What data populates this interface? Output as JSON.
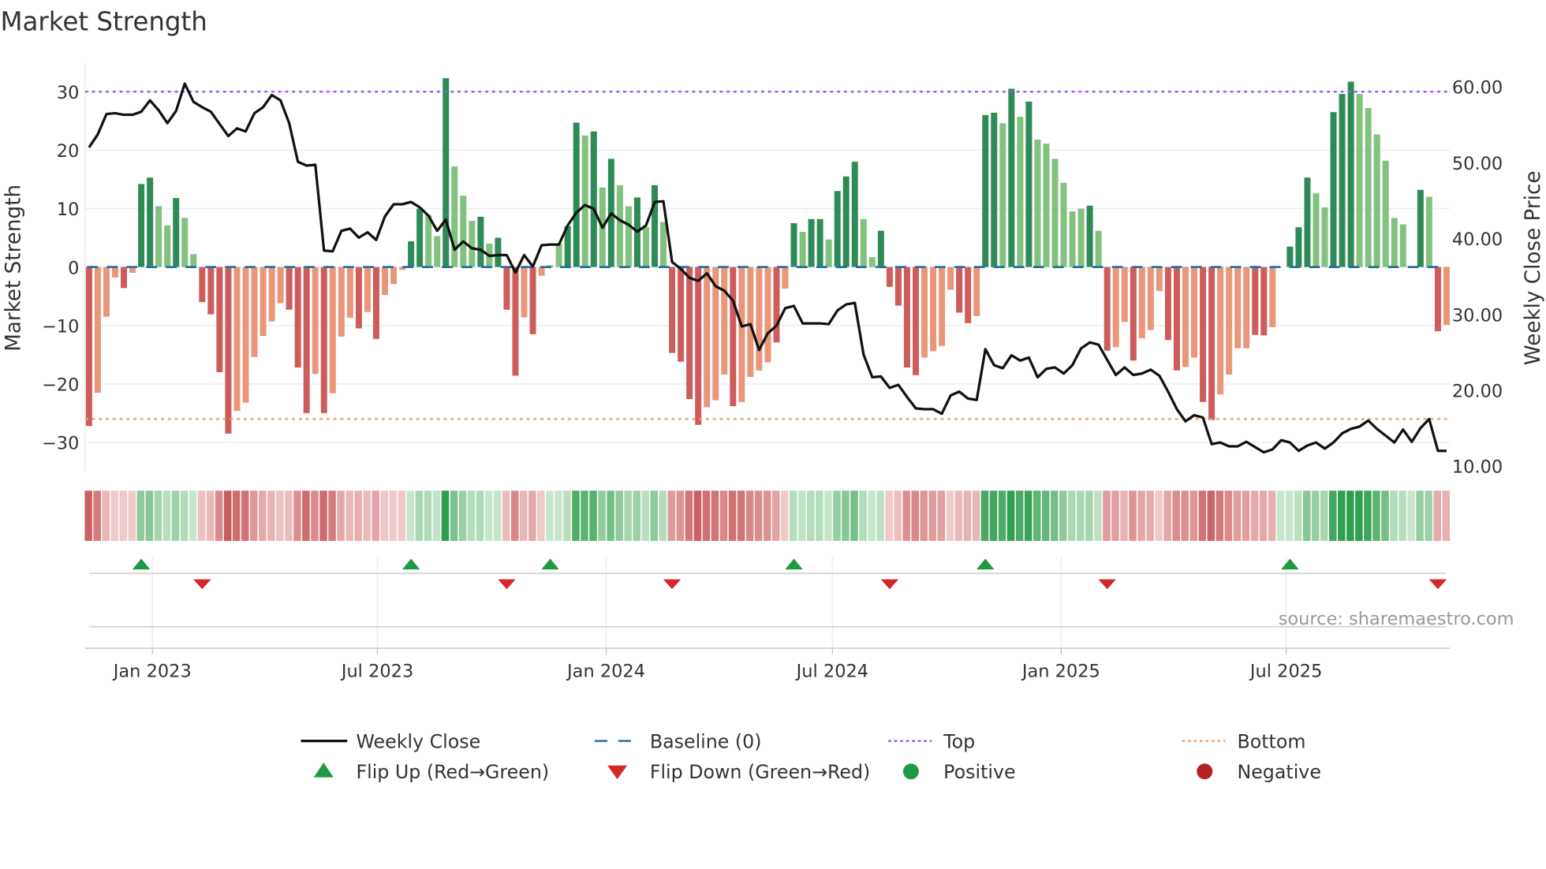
{
  "title": "Market Strength",
  "source": "source: sharemaestro.com",
  "colors": {
    "strong_pos": "#2e8b57",
    "weak_pos": "#82c17f",
    "strong_neg": "#cd5c5c",
    "weak_neg": "#e9967a",
    "baseline": "#2a6f97",
    "top": "#9b5de5",
    "bottom": "#f4a261",
    "close": "#111111",
    "flip_up": "#1e9a45",
    "flip_down": "#d62728",
    "positive": "#1e9a45",
    "negative": "#b22222"
  },
  "legend": [
    {
      "label": "Weekly Close",
      "kind": "line"
    },
    {
      "label": "Baseline (0)",
      "kind": "baseline"
    },
    {
      "label": "Top",
      "kind": "top"
    },
    {
      "label": "Bottom",
      "kind": "bottom"
    },
    {
      "label": "Flip Up (Red→Green)",
      "kind": "flip_up"
    },
    {
      "label": "Flip Down (Green→Red)",
      "kind": "flip_down"
    },
    {
      "label": "Positive",
      "kind": "positive"
    },
    {
      "label": "Negative",
      "kind": "negative"
    }
  ],
  "chart_data": {
    "type": "bar",
    "title": "Market Strength",
    "ylabel": "Market Strength",
    "y2label": "Weekly Close Price",
    "ylim": [
      -31,
      34
    ],
    "y2lim": [
      9.3,
      63
    ],
    "yticks": [
      "30",
      "20",
      "10",
      "0",
      "−10",
      "−20",
      "−30"
    ],
    "ytick_values": [
      30,
      20,
      10,
      0,
      -10,
      -20,
      -30
    ],
    "y2ticks": [
      "60.00",
      "50.00",
      "40.00",
      "30.00",
      "20.00",
      "10.00"
    ],
    "y2tick_values": [
      60,
      50,
      40,
      30,
      20,
      10
    ],
    "xticks": [
      {
        "label": "Jan 2023",
        "date": "2023-01-01"
      },
      {
        "label": "Jul 2023",
        "date": "2023-07-01"
      },
      {
        "label": "Jan 2024",
        "date": "2024-01-01"
      },
      {
        "label": "Jul 2024",
        "date": "2024-07-01"
      },
      {
        "label": "Jan 2025",
        "date": "2025-01-01"
      },
      {
        "label": "Jul 2025",
        "date": "2025-07-01"
      }
    ],
    "start_date": "2022-11-11",
    "frequency": "weekly",
    "top_level": 30,
    "bottom_level": -26,
    "grid": true,
    "legend_position": "bottom",
    "strength": [
      -27.2,
      -21.5,
      -8.5,
      -1.8,
      -3.6,
      -1,
      14.2,
      15.3,
      10.4,
      7.1,
      11.8,
      8.4,
      2.2,
      -6,
      -8.1,
      -18,
      -28.5,
      -24.6,
      -23.2,
      -15.4,
      -11.8,
      -9.3,
      -6.2,
      -7.3,
      -17.2,
      -25,
      -18.3,
      -25,
      -21.6,
      -11.9,
      -8.7,
      -10.5,
      -7.7,
      -12.3,
      -4.8,
      -2.9,
      -0.5,
      4.4,
      10,
      8.9,
      5.3,
      32.3,
      17.2,
      12.2,
      7.9,
      8.6,
      4,
      5,
      -7.3,
      -18.6,
      -8.6,
      -11.5,
      -1.5,
      0.3,
      4,
      7,
      24.7,
      22.5,
      23.2,
      13.6,
      18.5,
      14,
      10.4,
      11.9,
      6.8,
      14,
      7.7,
      -14.7,
      -16.2,
      -22.6,
      -27,
      -24,
      -22.8,
      -18.4,
      -23.8,
      -23.1,
      -18.8,
      -17.7,
      -16.3,
      -12.9,
      -3.7,
      7.5,
      6,
      8.2,
      8.2,
      4.7,
      13,
      15.5,
      18,
      8.2,
      1.7,
      6.2,
      -3.4,
      -6.6,
      -17.2,
      -18.5,
      -15.5,
      -14.4,
      -13.5,
      -3.9,
      -7.8,
      -9.6,
      -8.4,
      26,
      26.4,
      24.6,
      30.5,
      25.7,
      28.3,
      21.8,
      21.1,
      18.5,
      14.4,
      9.5,
      10,
      10.5,
      6.2,
      -14.3,
      -13.7,
      -9.4,
      -16,
      -12.2,
      -10.8,
      -4.1,
      -12.5,
      -17.7,
      -17.1,
      -15.5,
      -23.1,
      -26.2,
      -21.8,
      -18.4,
      -13.9,
      -13.9,
      -11.6,
      -11.7,
      -10.3,
      0,
      3.5,
      6.8,
      15.3,
      12.6,
      10.2,
      26.5,
      29.6,
      31.7,
      29.6,
      27.2,
      22.7,
      18.2,
      8.4,
      7.3,
      0,
      13.2,
      12,
      -11,
      -9.9
    ],
    "strong": [
      1,
      0,
      0,
      0,
      1,
      0,
      1,
      1,
      0,
      0,
      1,
      0,
      0,
      1,
      1,
      1,
      1,
      0,
      0,
      0,
      0,
      0,
      0,
      1,
      1,
      1,
      0,
      1,
      0,
      0,
      0,
      1,
      0,
      1,
      0,
      0,
      0,
      1,
      1,
      0,
      0,
      1,
      0,
      0,
      0,
      1,
      0,
      1,
      1,
      1,
      0,
      1,
      0,
      0,
      0,
      1,
      1,
      0,
      1,
      0,
      1,
      0,
      0,
      1,
      0,
      1,
      0,
      1,
      1,
      1,
      1,
      0,
      0,
      0,
      1,
      0,
      0,
      0,
      0,
      1,
      0,
      1,
      0,
      1,
      1,
      0,
      1,
      1,
      1,
      0,
      0,
      1,
      1,
      1,
      1,
      1,
      0,
      0,
      0,
      0,
      1,
      1,
      0,
      1,
      1,
      0,
      1,
      0,
      1,
      0,
      0,
      0,
      0,
      0,
      0,
      1,
      0,
      1,
      0,
      0,
      1,
      0,
      0,
      0,
      1,
      1,
      0,
      0,
      1,
      1,
      0,
      0,
      0,
      0,
      1,
      1,
      0,
      0,
      1,
      1,
      1,
      0,
      0,
      1,
      1,
      1,
      0,
      0,
      0,
      0,
      0,
      0,
      0,
      1,
      0,
      1,
      0
    ],
    "close": [
      52,
      53.7,
      56.4,
      56.5,
      56.3,
      56.3,
      56.7,
      58.2,
      56.9,
      55.2,
      56.8,
      60.4,
      58,
      57.3,
      56.7,
      55.1,
      53.5,
      54.5,
      54.1,
      56.5,
      57.3,
      58.9,
      58.2,
      55.2,
      50.1,
      49.6,
      49.7,
      38.4,
      38.3,
      41,
      41.3,
      40.1,
      40.8,
      39.8,
      42.9,
      44.5,
      44.5,
      44.8,
      44.1,
      43,
      41,
      42.5,
      38.5,
      39.6,
      38.7,
      38.5,
      37.7,
      37.8,
      37.8,
      35.5,
      37.8,
      36.3,
      39.1,
      39.2,
      39.2,
      41.7,
      43.4,
      44.4,
      43.9,
      41.4,
      43.3,
      42.4,
      41.8,
      40.9,
      41.7,
      44.8,
      44.9,
      36.9,
      36,
      34.8,
      34.4,
      35.4,
      33.7,
      33.1,
      31.8,
      28.4,
      28.7,
      25.3,
      27.5,
      28.5,
      30.8,
      31.1,
      28.8,
      28.8,
      28.8,
      28.7,
      30.5,
      31.3,
      31.5,
      24.7,
      21.7,
      21.8,
      20.3,
      20.7,
      19.1,
      17.6,
      17.5,
      17.5,
      16.9,
      19.3,
      19.8,
      18.9,
      18.7,
      25.4,
      23.3,
      22.9,
      24.6,
      23.9,
      24.3,
      21.7,
      22.8,
      23,
      22.2,
      23.3,
      25.5,
      26.3,
      26,
      24,
      22,
      23,
      22,
      22.2,
      22.7,
      21.9,
      19.8,
      17.5,
      15.9,
      16.7,
      16.4,
      12.9,
      13.1,
      12.6,
      12.6,
      13.2,
      12.5,
      11.8,
      12.2,
      13.4,
      13.1,
      12,
      12.7,
      13.1,
      12.3,
      13.1,
      14.3,
      14.9,
      15.2,
      16,
      14.9,
      14,
      13.1,
      14.8,
      13.2,
      15,
      16.2,
      12,
      12
    ]
  }
}
